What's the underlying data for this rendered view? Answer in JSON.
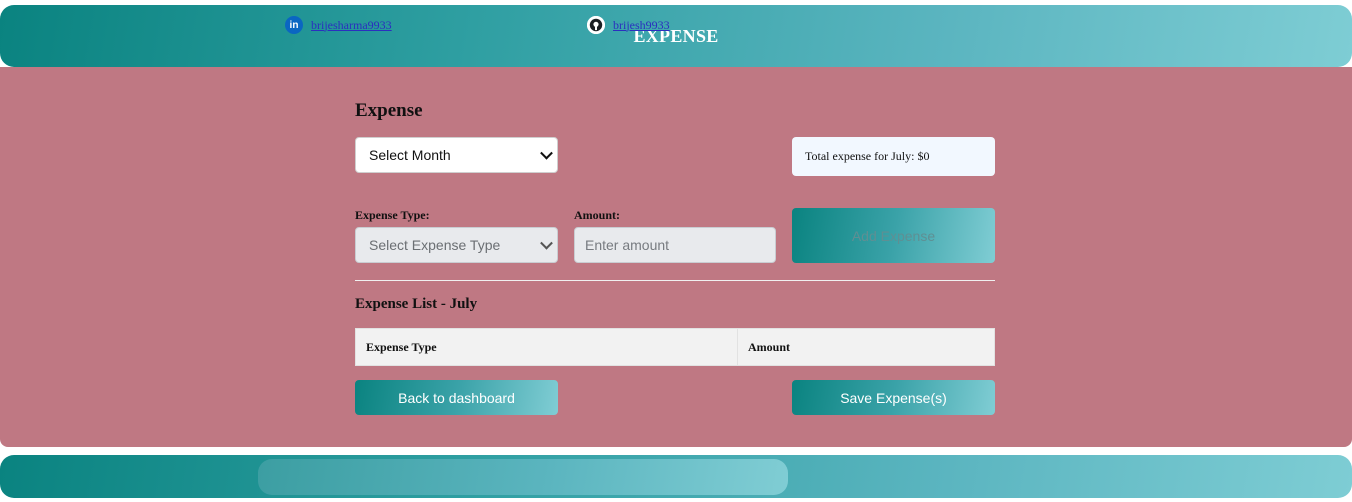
{
  "header": {
    "title": "EXPENSE"
  },
  "main": {
    "section_title": "Expense",
    "month_select": {
      "value": "Select Month"
    },
    "total_text": "Total expense for July: $0",
    "expense_type_label": "Expense Type:",
    "expense_type_select": {
      "value": "Select Expense Type"
    },
    "amount_label": "Amount:",
    "amount_input": {
      "placeholder": "Enter amount",
      "value": ""
    },
    "add_button": "Add Expense",
    "list_title": "Expense List - July",
    "table": {
      "columns": [
        "Expense Type",
        "Amount"
      ],
      "rows": []
    },
    "back_button": "Back to dashboard",
    "save_button": "Save Expense(s)"
  },
  "footer": {
    "linkedin": {
      "icon": "linkedin-icon",
      "text": "brijesharma9933"
    },
    "github": {
      "icon": "github-icon",
      "text": "brijesh9933"
    }
  },
  "colors": {
    "header_gradient_start": "#0a8380",
    "header_gradient_end": "#7ecdd4",
    "main_bg": "#bf7883",
    "total_box_bg": "#f2f8ff",
    "table_header_bg": "#f2f2f2",
    "link": "#2b2fbf"
  }
}
